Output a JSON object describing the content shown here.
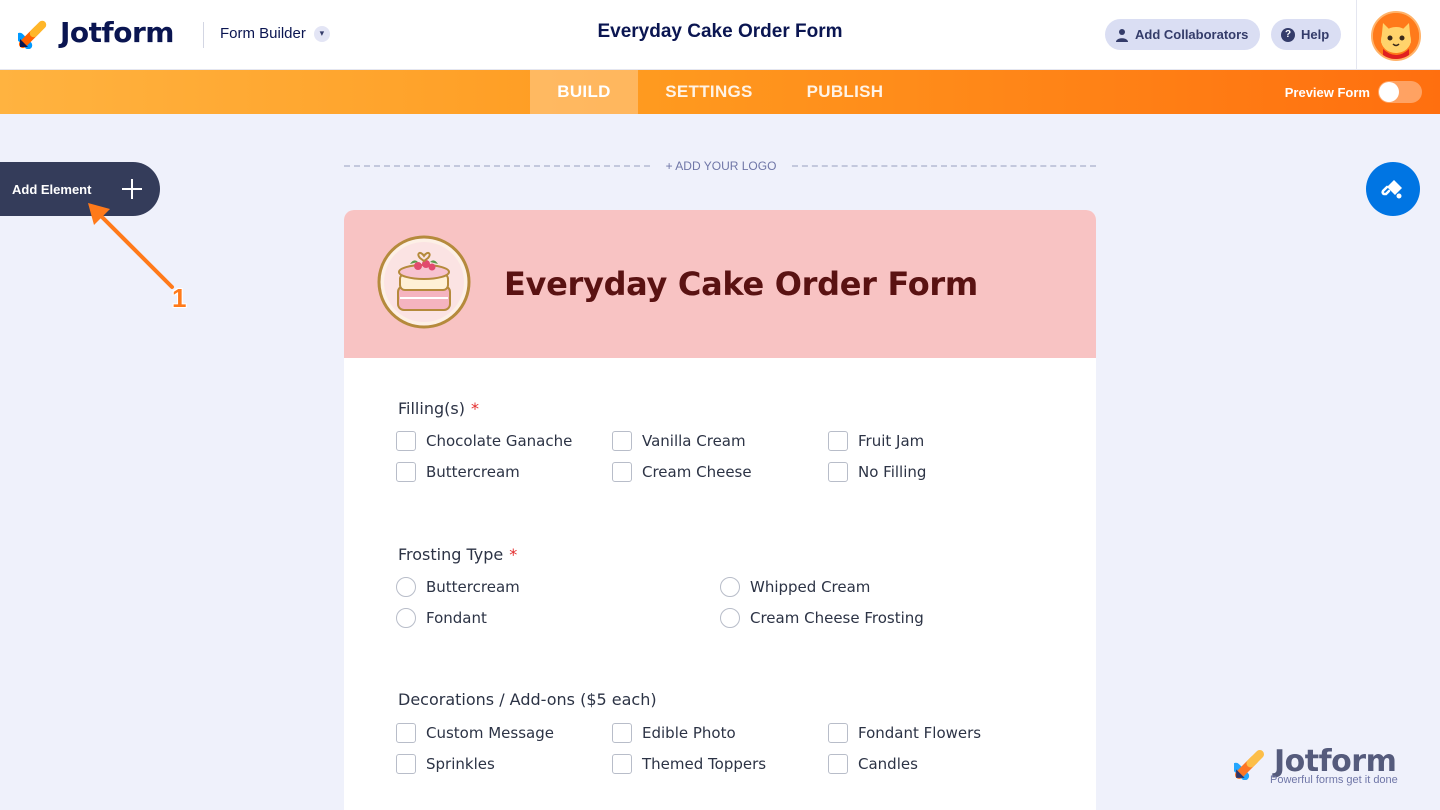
{
  "app": {
    "brand": "Jotform",
    "builder_label": "Form Builder",
    "form_title": "Everyday Cake Order Form",
    "add_collaborators": "Add Collaborators",
    "help": "Help"
  },
  "nav": {
    "tabs": [
      {
        "label": "BUILD",
        "active": true
      },
      {
        "label": "SETTINGS",
        "active": false
      },
      {
        "label": "PUBLISH",
        "active": false
      }
    ],
    "preview_label": "Preview Form",
    "preview_on": false
  },
  "sidebar": {
    "add_element": "Add Element"
  },
  "annotation": {
    "number": "1"
  },
  "form": {
    "add_logo": "+ ADD YOUR LOGO",
    "heading": "Everyday Cake Order Form",
    "fillings": {
      "label": "Filling(s)",
      "required": "*",
      "options": [
        "Chocolate Ganache",
        "Vanilla Cream",
        "Fruit Jam",
        "Buttercream",
        "Cream Cheese",
        "No Filling"
      ]
    },
    "frosting": {
      "label": "Frosting Type",
      "required": "*",
      "options": [
        "Buttercream",
        "Whipped Cream",
        "Fondant",
        "Cream Cheese Frosting"
      ]
    },
    "decorations": {
      "label": "Decorations / Add-ons ($5 each)",
      "options": [
        "Custom Message",
        "Edible Photo",
        "Fondant Flowers",
        "Sprinkles",
        "Themed Toppers",
        "Candles"
      ]
    }
  },
  "watermark": {
    "brand": "Jotform",
    "tagline": "Powerful forms get it done"
  },
  "colors": {
    "brand_navy": "#0a1551",
    "orange": "#ff7a1a",
    "header_pink": "#f8c3c3",
    "heading_maroon": "#5a1212",
    "blue_button": "#0075e3"
  }
}
